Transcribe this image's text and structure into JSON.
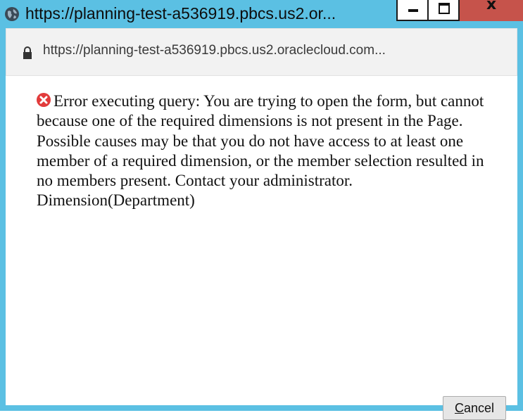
{
  "window": {
    "title": "https://planning-test-a536919.pbcs.us2.or...",
    "controls": {
      "minimize_icon": "minimize-icon",
      "maximize_icon": "maximize-icon",
      "close_label": "x"
    },
    "close_color": "#c6534b",
    "frame_color": "#5bc0e3"
  },
  "address_bar": {
    "url": "https://planning-test-a536919.pbcs.us2.oraclecloud.com...",
    "icon": "lock-icon"
  },
  "dialog": {
    "icon": "error-icon",
    "icon_color": "#e23b3b",
    "message": "Error executing query: You are trying to open the form, but cannot because one of the required dimensions is not present in the Page. Possible causes may be that you do not have access to at least one member of a required dimension, or the member selection resulted in no members present. Contact your administrator. Dimension(Department)",
    "cancel_button": {
      "accesskey_char": "C",
      "rest": "ancel"
    }
  }
}
